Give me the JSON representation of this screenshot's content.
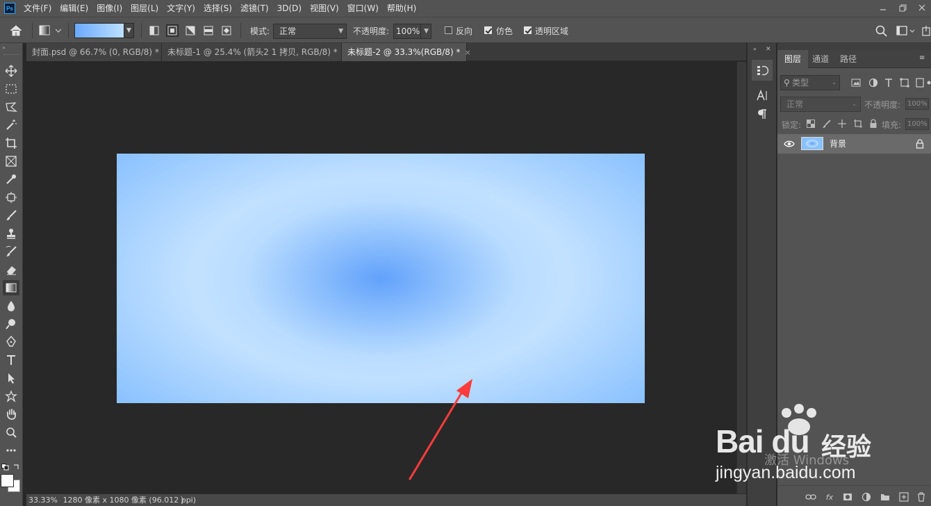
{
  "app": {
    "logo": "Ps"
  },
  "menu": [
    "文件(F)",
    "编辑(E)",
    "图像(I)",
    "图层(L)",
    "文字(Y)",
    "选择(S)",
    "滤镜(T)",
    "3D(D)",
    "视图(V)",
    "窗口(W)",
    "帮助(H)"
  ],
  "options": {
    "mode_label": "模式:",
    "mode_value": "正常",
    "opacity_label": "不透明度:",
    "opacity_value": "100%",
    "reverse_label": "反向",
    "reverse_checked": false,
    "dither_label": "仿色",
    "dither_checked": true,
    "transparency_label": "透明区域",
    "transparency_checked": true,
    "gradient_colors": [
      "#6aa9ff",
      "#bde0ff"
    ],
    "active_gradient_type": "radial"
  },
  "tabs": [
    {
      "label": "封面.psd @ 66.7% (0, RGB/8) *",
      "close": "×",
      "active": false
    },
    {
      "label": "未标题-1 @ 25.4% (箭头2 1 拷贝, RGB/8) *",
      "close": "×",
      "active": false
    },
    {
      "label": "未标题-2 @ 33.3%(RGB/8) *",
      "close": "×",
      "active": true
    }
  ],
  "document": {
    "center_color": "#62a2fb",
    "edge_color": "#c2e1ff",
    "outer_color": "#7ebbff"
  },
  "status": {
    "zoom": "33.33%",
    "info": "1280 像素 x 1080 像素 (96.012 ppi)",
    "more": "〉"
  },
  "layers_panel": {
    "tabs": [
      "图层",
      "通道",
      "路径"
    ],
    "active_tab": "图层",
    "filter_placeholder": "类型",
    "blend_mode": "正常",
    "opacity_label": "不透明度:",
    "opacity_value": "100%",
    "lock_label": "锁定:",
    "fill_label": "填充:",
    "fill_value": "100%",
    "layers": [
      {
        "name": "背景",
        "visible": true,
        "locked": true
      }
    ]
  },
  "watermark": {
    "logo": "Bai du",
    "brand_cn": "经验",
    "url": "jingyan.baidu.com",
    "activate": "激活 Windows"
  },
  "annotation": {
    "color": "#ff3b3b"
  }
}
